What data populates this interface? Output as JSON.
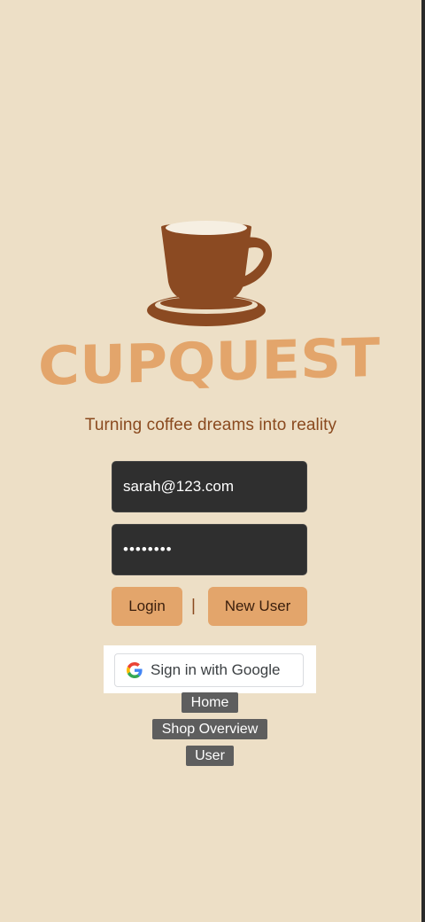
{
  "brand": {
    "name": "CUPQUEST",
    "tagline": "Turning coffee dreams into reality",
    "cup_color": "#8b4a22",
    "wordmark_color": "#e3a56b"
  },
  "login_form": {
    "email_value": "sarah@123.com",
    "password_value": "••••••••",
    "login_label": "Login",
    "divider": "|",
    "new_user_label": "New User"
  },
  "google": {
    "label": "Sign in with Google",
    "icon": "google-g-icon"
  },
  "nav": {
    "home": "Home",
    "shop_overview": "Shop Overview",
    "user": "User"
  },
  "colors": {
    "background": "#eddfc6",
    "button": "#e3a56b",
    "field": "#2f2f2f",
    "nav_link": "#5e5e5e"
  }
}
